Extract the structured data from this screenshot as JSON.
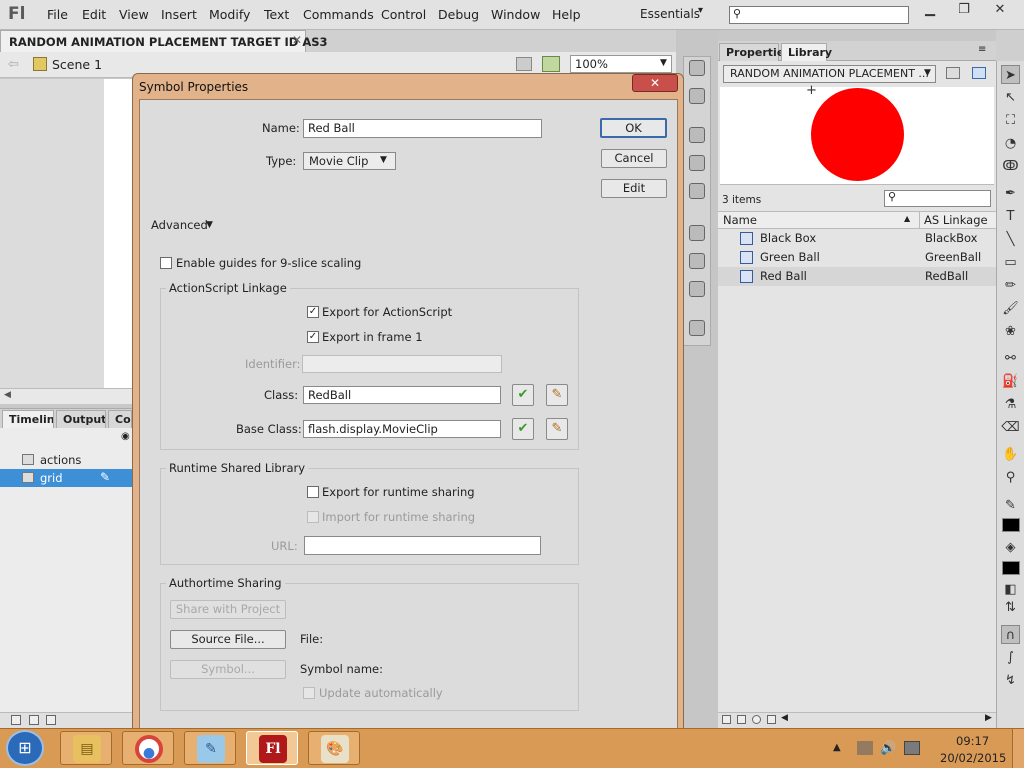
{
  "app": {
    "logo": "Fl"
  },
  "menu": [
    "File",
    "Edit",
    "View",
    "Insert",
    "Modify",
    "Text",
    "Commands",
    "Control",
    "Debug",
    "Window",
    "Help"
  ],
  "workspace": {
    "label": "Essentials"
  },
  "document": {
    "tab": "RANDOM ANIMATION PLACEMENT TARGET ID AS3",
    "scene": "Scene 1",
    "zoom": "100%"
  },
  "timeline": {
    "tabs": [
      "Timeline",
      "Output",
      "Compiler Errors"
    ],
    "layers": [
      "actions",
      "grid"
    ]
  },
  "library": {
    "tabs": [
      "Properties",
      "Library"
    ],
    "doc_select": "RANDOM ANIMATION PLACEMENT ...",
    "item_count": "3 items",
    "columns": [
      "Name",
      "AS Linkage"
    ],
    "items": [
      {
        "name": "Black Box",
        "linkage": "BlackBox"
      },
      {
        "name": "Green Ball",
        "linkage": "GreenBall"
      },
      {
        "name": "Red Ball",
        "linkage": "RedBall"
      }
    ],
    "preview_color": "#ff0000"
  },
  "dialog": {
    "title": "Symbol Properties",
    "name_label": "Name:",
    "name_value": "Red Ball",
    "type_label": "Type:",
    "type_value": "Movie Clip",
    "ok": "OK",
    "cancel": "Cancel",
    "edit": "Edit",
    "advanced": "Advanced",
    "nine_slice": "Enable guides for 9-slice scaling",
    "as_linkage": {
      "title": "ActionScript Linkage",
      "export_as": "Export for ActionScript",
      "export_frame1": "Export in frame 1",
      "identifier_label": "Identifier:",
      "class_label": "Class:",
      "class_value": "RedBall",
      "base_label": "Base Class:",
      "base_value": "flash.display.MovieClip"
    },
    "runtime": {
      "title": "Runtime Shared Library",
      "export_rt": "Export for runtime sharing",
      "import_rt": "Import for runtime sharing",
      "url_label": "URL:"
    },
    "authortime": {
      "title": "Authortime Sharing",
      "share_project": "Share with Project",
      "source_file": "Source File...",
      "file_label": "File:",
      "symbol_btn": "Symbol...",
      "symbol_name_label": "Symbol name:",
      "update_auto": "Update automatically"
    }
  },
  "tray": {
    "time": "09:17",
    "date": "20/02/2015"
  }
}
